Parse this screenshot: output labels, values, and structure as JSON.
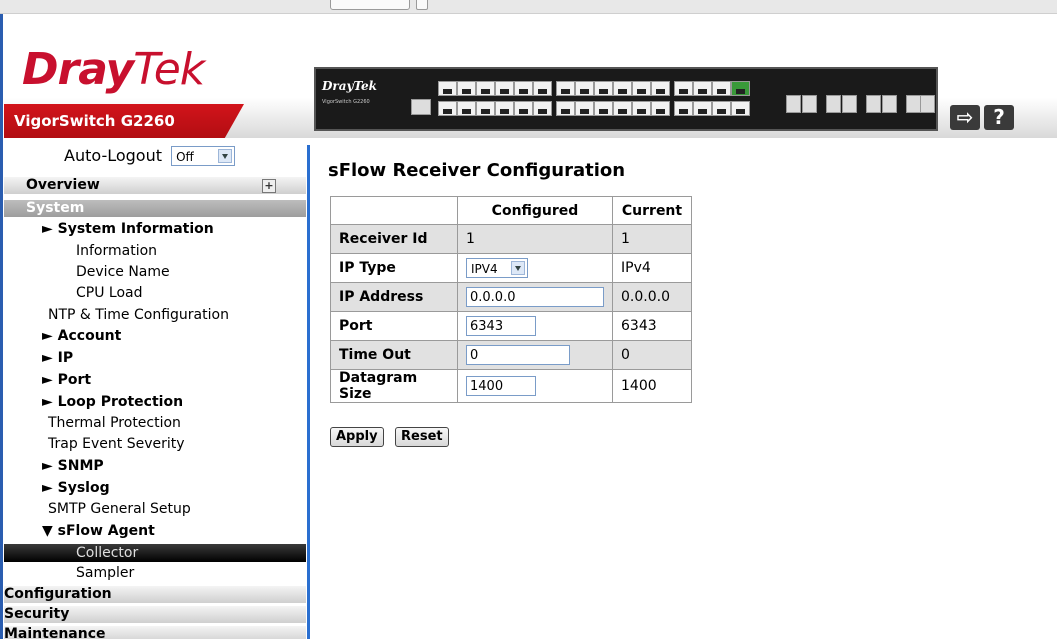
{
  "header": {
    "logo_dray": "Dray",
    "logo_tek": "Tek",
    "model": "VigorSwitch G2260",
    "device_brand": "DrayTek",
    "device_sub": "VigorSwitch G2260"
  },
  "sidebar": {
    "autologout_label": "Auto-Logout",
    "autologout_value": "Off",
    "overview": "Overview",
    "system": "System",
    "system_information": "► System Information",
    "information": "Information",
    "device_name": "Device Name",
    "cpu_load": "CPU Load",
    "ntp": "NTP & Time Configuration",
    "account": "► Account",
    "ip": "► IP",
    "port": "► Port",
    "loop_protection": "► Loop Protection",
    "thermal_protection": "Thermal Protection",
    "trap_event": "Trap Event Severity",
    "snmp": "► SNMP",
    "syslog": "► Syslog",
    "smtp": "SMTP General Setup",
    "sflow_agent": "▼ sFlow Agent",
    "collector": "Collector",
    "sampler": "Sampler",
    "configuration": "Configuration",
    "security": "Security",
    "maintenance": "Maintenance"
  },
  "main": {
    "title": "sFlow Receiver Configuration",
    "col_configured": "Configured",
    "col_current": "Current",
    "rows": [
      {
        "label": "Receiver Id",
        "configured": "1",
        "current": "1"
      },
      {
        "label": "IP Type",
        "configured": "IPV4",
        "current": "IPv4"
      },
      {
        "label": "IP Address",
        "configured": "0.0.0.0",
        "current": "0.0.0.0"
      },
      {
        "label": "Port",
        "configured": "6343",
        "current": "6343"
      },
      {
        "label": "Time Out",
        "configured": "0",
        "current": "0"
      },
      {
        "label": "Datagram Size",
        "configured": "1400",
        "current": "1400"
      }
    ],
    "apply": "Apply",
    "reset": "Reset"
  }
}
